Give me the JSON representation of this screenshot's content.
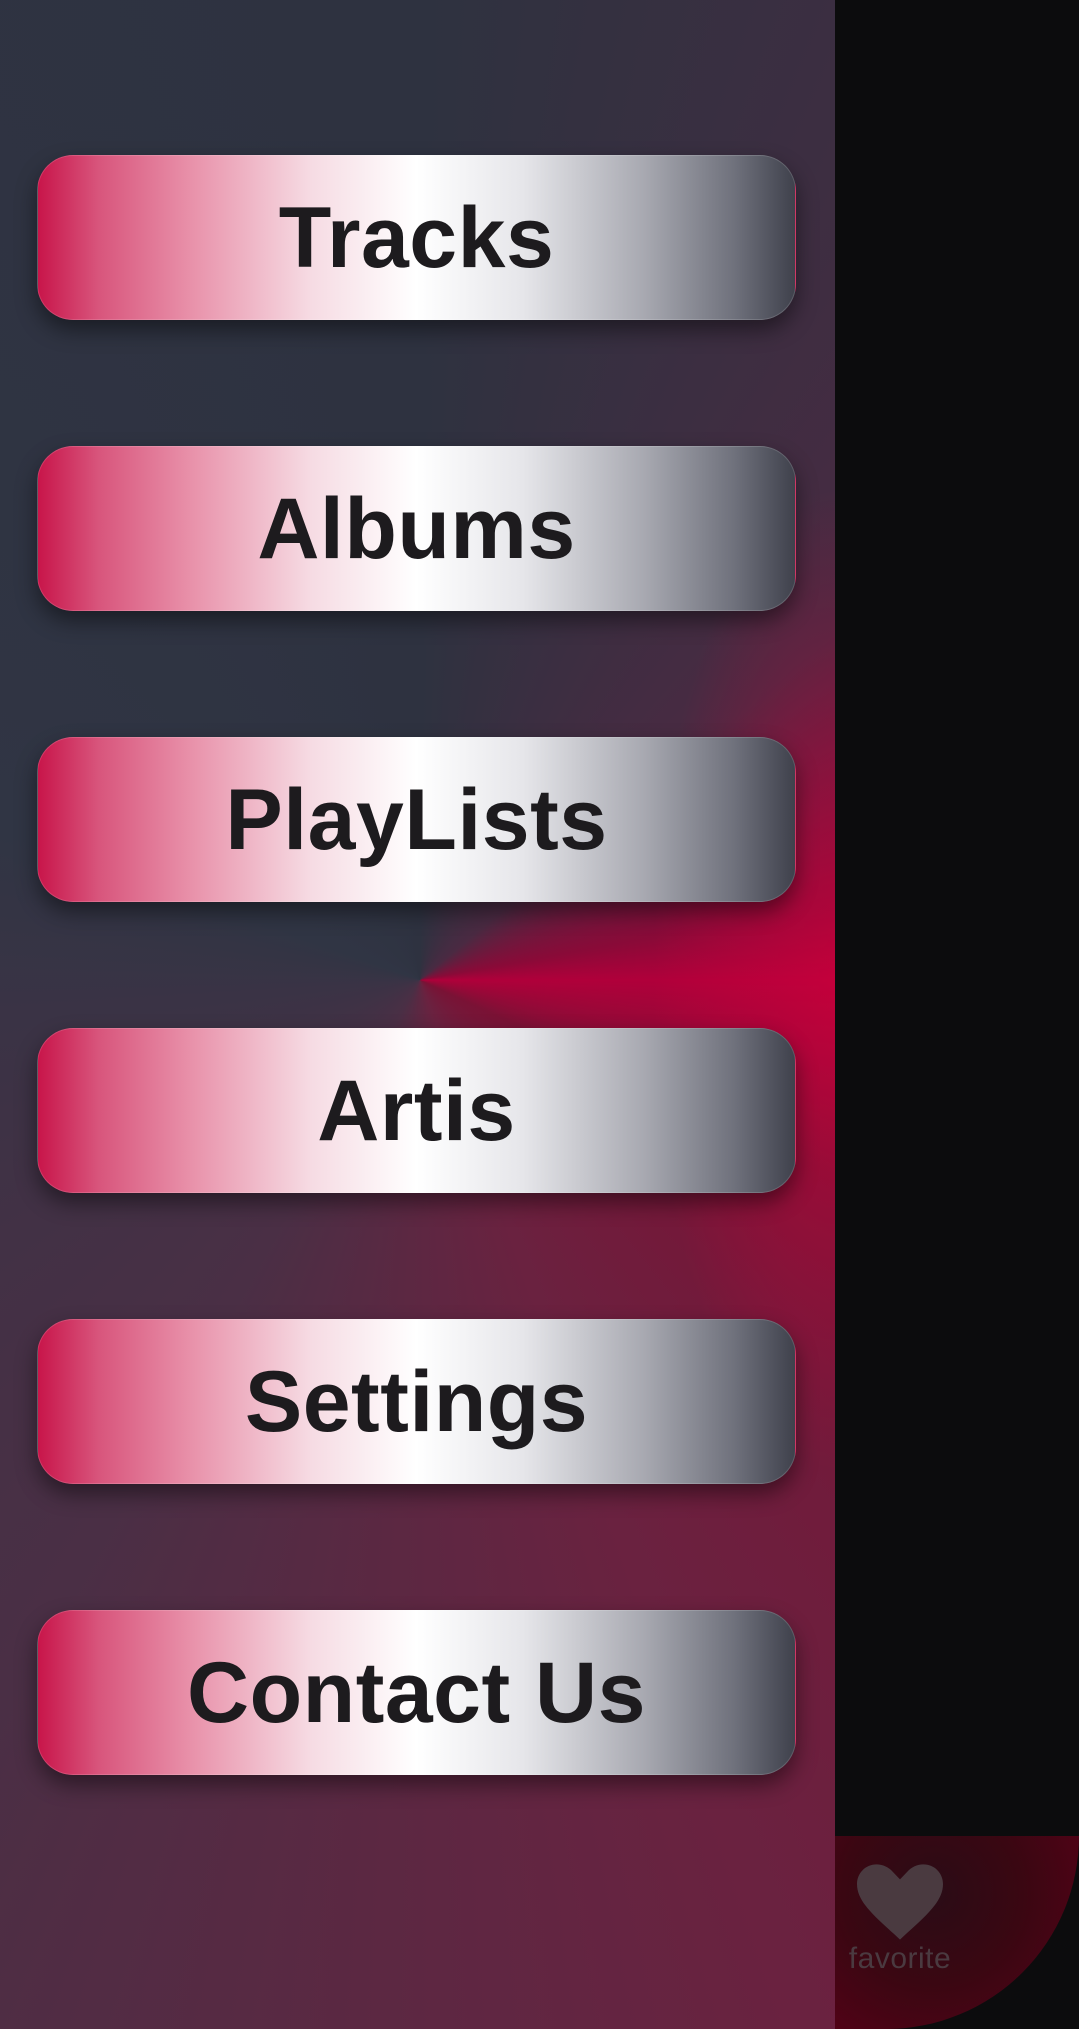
{
  "drawer": {
    "menu_items": [
      {
        "label": "Tracks"
      },
      {
        "label": "Albums"
      },
      {
        "label": "PlayLists"
      },
      {
        "label": "Artis"
      },
      {
        "label": "Settings"
      },
      {
        "label": "Contact Us"
      }
    ]
  },
  "bottom_nav": {
    "favorite": {
      "label": "favorite",
      "icon": "heart-icon"
    }
  },
  "colors": {
    "accent": "#c8154a",
    "drawer_dark": "#2e3240",
    "text": "#1d1b1e"
  }
}
